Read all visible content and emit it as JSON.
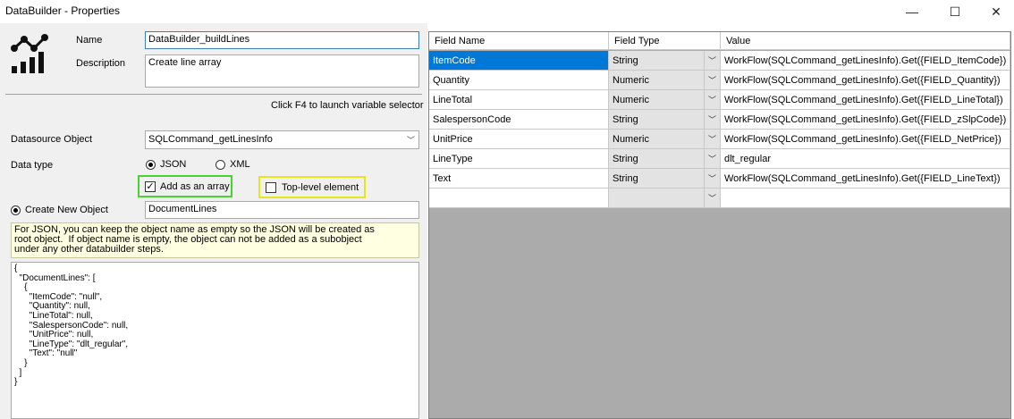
{
  "window": {
    "title": "DataBuilder - Properties",
    "minimize": "—",
    "maximize": "☐",
    "close": "✕"
  },
  "form": {
    "name_label": "Name",
    "name_value": "DataBuilder_buildLines",
    "description_label": "Description",
    "description_value": "Create line array",
    "hint": "Click F4 to launch variable selector",
    "datasource_label": "Datasource Object",
    "datasource_value": "SQLCommand_getLinesInfo",
    "datatype_label": "Data type",
    "datatype_options": [
      "JSON",
      "XML"
    ],
    "datatype_selected": "JSON",
    "add_array_label": "Add as an array",
    "add_array_checked": true,
    "top_level_label": "Top-level element",
    "top_level_checked": false,
    "create_new_object_label": "Create New Object",
    "object_name_value": "DocumentLines",
    "info_text": "For JSON, you can keep the object name as empty so the JSON will be created as\nroot object.  If object name is empty, the object can not be added as a subobject\nunder any other databuilder steps.",
    "json_preview": "{\n  \"DocumentLines\": [\n    {\n      \"ItemCode\": \"null\",\n      \"Quantity\": null,\n      \"LineTotal\": null,\n      \"SalespersonCode\": null,\n      \"UnitPrice\": null,\n      \"LineType\": \"dlt_regular\",\n      \"Text\": \"null\"\n    }\n  ]\n}"
  },
  "grid": {
    "columns": [
      "Field Name",
      "Field Type",
      "Value"
    ],
    "rows": [
      {
        "field": "ItemCode",
        "type": "String",
        "value": "WorkFlow(SQLCommand_getLinesInfo).Get({FIELD_ItemCode})"
      },
      {
        "field": "Quantity",
        "type": "Numeric",
        "value": "WorkFlow(SQLCommand_getLinesInfo).Get({FIELD_Quantity})"
      },
      {
        "field": "LineTotal",
        "type": "Numeric",
        "value": "WorkFlow(SQLCommand_getLinesInfo).Get({FIELD_LineTotal})"
      },
      {
        "field": "SalespersonCode",
        "type": "String",
        "value": "WorkFlow(SQLCommand_getLinesInfo).Get({FIELD_zSlpCode})"
      },
      {
        "field": "UnitPrice",
        "type": "Numeric",
        "value": "WorkFlow(SQLCommand_getLinesInfo).Get({FIELD_NetPrice})"
      },
      {
        "field": "LineType",
        "type": "String",
        "value": "dlt_regular"
      },
      {
        "field": "Text",
        "type": "String",
        "value": "WorkFlow(SQLCommand_getLinesInfo).Get({FIELD_LineText})"
      },
      {
        "field": "",
        "type": "",
        "value": ""
      }
    ],
    "selected_row": 0
  },
  "colors": {
    "selection": "#0078d7",
    "highlight_green": "#44d62c",
    "highlight_yellow": "#e6e61e"
  }
}
